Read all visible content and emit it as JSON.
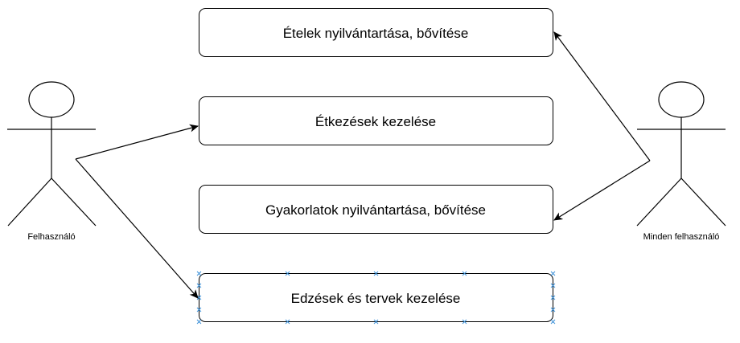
{
  "actors": {
    "left": {
      "label": "Felhasználó"
    },
    "right": {
      "label": "Minden felhasználó"
    }
  },
  "use_cases": [
    {
      "label": "Ételek nyilvántartása, bővítése"
    },
    {
      "label": "Étkezések kezelése"
    },
    {
      "label": "Gyakorlatok nyilvántartása, bővítése"
    },
    {
      "label": "Edzések és tervek kezelése"
    }
  ],
  "colors": {
    "stroke": "#000000",
    "selection": "#3a8fd8",
    "background": "#ffffff"
  },
  "selected_use_case": 3
}
